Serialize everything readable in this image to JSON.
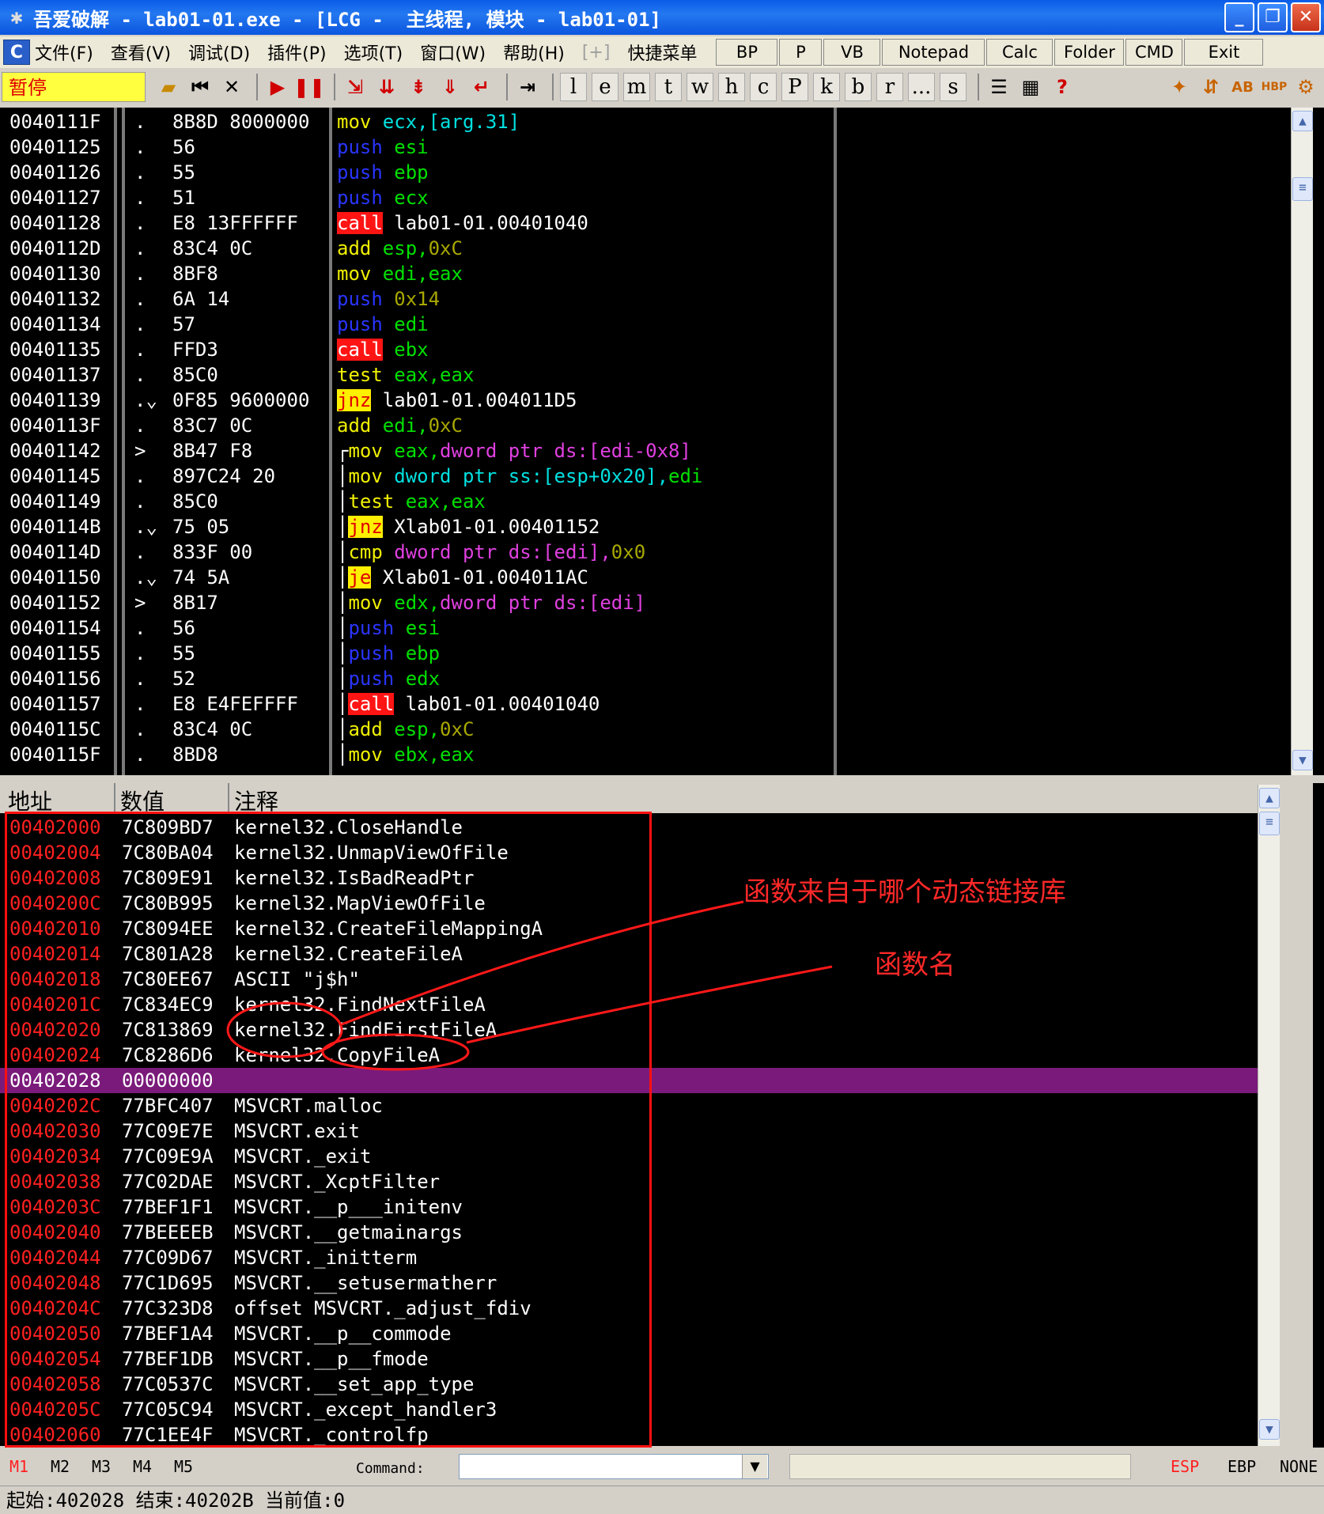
{
  "window": {
    "title": "吾爱破解 - lab01-01.exe - [LCG -  主线程, 模块 - lab01-01]"
  },
  "menu": {
    "items": [
      "文件(F)",
      "查看(V)",
      "调试(D)",
      "插件(P)",
      "选项(T)",
      "窗口(W)",
      "帮助(H)",
      "[+]",
      "快捷菜单"
    ],
    "plugin_buttons": [
      "BP",
      "P",
      "VB",
      "Notepad",
      "Calc",
      "Folder",
      "CMD",
      "Exit"
    ]
  },
  "toolbar": {
    "status": "暂停",
    "letter_buttons": [
      "l",
      "e",
      "m",
      "t",
      "w",
      "h",
      "c",
      "P",
      "k",
      "b",
      "r",
      "...",
      "s"
    ]
  },
  "disasm": {
    "rows": [
      {
        "addr": "0040111F",
        "mark": ".",
        "hex": "8B8D 8000000",
        "ins": [
          [
            "mov ",
            "c-yel"
          ],
          [
            "ecx,[arg.31]",
            "c-cyan"
          ]
        ]
      },
      {
        "addr": "00401125",
        "mark": ".",
        "hex": "56",
        "ins": [
          [
            "push ",
            "c-blue"
          ],
          [
            "esi",
            "c-green"
          ]
        ]
      },
      {
        "addr": "00401126",
        "mark": ".",
        "hex": "55",
        "ins": [
          [
            "push ",
            "c-blue"
          ],
          [
            "ebp",
            "c-green"
          ]
        ]
      },
      {
        "addr": "00401127",
        "mark": ".",
        "hex": "51",
        "ins": [
          [
            "push ",
            "c-blue"
          ],
          [
            "ecx",
            "c-green"
          ]
        ]
      },
      {
        "addr": "00401128",
        "mark": ".",
        "hex": "E8 13FFFFFF",
        "ins": [
          [
            "call",
            "c-red-bg"
          ],
          [
            " lab01-01.00401040",
            "c-white"
          ]
        ]
      },
      {
        "addr": "0040112D",
        "mark": ".",
        "hex": "83C4 0C",
        "ins": [
          [
            "add ",
            "c-yel"
          ],
          [
            "esp,",
            "c-green"
          ],
          [
            "0xC",
            "c-olive"
          ]
        ]
      },
      {
        "addr": "00401130",
        "mark": ".",
        "hex": "8BF8",
        "ins": [
          [
            "mov ",
            "c-yel"
          ],
          [
            "edi,eax",
            "c-green"
          ]
        ]
      },
      {
        "addr": "00401132",
        "mark": ".",
        "hex": "6A 14",
        "ins": [
          [
            "push ",
            "c-blue"
          ],
          [
            "0x14",
            "c-olive"
          ]
        ]
      },
      {
        "addr": "00401134",
        "mark": ".",
        "hex": "57",
        "ins": [
          [
            "push ",
            "c-blue"
          ],
          [
            "edi",
            "c-green"
          ]
        ]
      },
      {
        "addr": "00401135",
        "mark": ".",
        "hex": "FFD3",
        "ins": [
          [
            "call",
            "c-red-bg"
          ],
          [
            " ebx",
            "c-green"
          ]
        ]
      },
      {
        "addr": "00401137",
        "mark": ".",
        "hex": "85C0",
        "ins": [
          [
            "test ",
            "c-yel"
          ],
          [
            "eax,eax",
            "c-green"
          ]
        ]
      },
      {
        "addr": "00401139",
        "mark": ".⌄",
        "hex": "0F85 9600000",
        "ins": [
          [
            "jnz",
            "c-yel-bg"
          ],
          [
            " lab01-01.004011D5",
            "c-white"
          ]
        ]
      },
      {
        "addr": "0040113F",
        "mark": ".",
        "hex": "83C7 0C",
        "ins": [
          [
            "add ",
            "c-yel"
          ],
          [
            "edi,",
            "c-green"
          ],
          [
            "0xC",
            "c-olive"
          ]
        ]
      },
      {
        "addr": "00401142",
        "mark": ">",
        "hex": "8B47 F8",
        "ins": [
          [
            "┌",
            "c-white"
          ],
          [
            "mov ",
            "c-yel"
          ],
          [
            "eax,",
            "c-green"
          ],
          [
            "dword ptr ds:[edi-0x8]",
            "c-mag"
          ]
        ]
      },
      {
        "addr": "00401145",
        "mark": ".",
        "hex": "897C24 20",
        "ins": [
          [
            "│",
            "c-white"
          ],
          [
            "mov ",
            "c-yel"
          ],
          [
            "dword ptr ss:[esp+0x20],",
            "c-cyan"
          ],
          [
            "edi",
            "c-green"
          ]
        ]
      },
      {
        "addr": "00401149",
        "mark": ".",
        "hex": "85C0",
        "ins": [
          [
            "│",
            "c-white"
          ],
          [
            "test ",
            "c-yel"
          ],
          [
            "eax,eax",
            "c-green"
          ]
        ]
      },
      {
        "addr": "0040114B",
        "mark": ".⌄",
        "hex": "75 05",
        "ins": [
          [
            "│",
            "c-white"
          ],
          [
            "jnz",
            "c-yel-bg"
          ],
          [
            " Xlab01-01.00401152",
            "c-white"
          ]
        ]
      },
      {
        "addr": "0040114D",
        "mark": ".",
        "hex": "833F 00",
        "ins": [
          [
            "│",
            "c-white"
          ],
          [
            "cmp ",
            "c-yel"
          ],
          [
            "dword ptr ds:[edi],",
            "c-mag"
          ],
          [
            "0x0",
            "c-olive"
          ]
        ]
      },
      {
        "addr": "00401150",
        "mark": ".⌄",
        "hex": "74 5A",
        "ins": [
          [
            "│",
            "c-white"
          ],
          [
            "je",
            "c-yel-bg"
          ],
          [
            " Xlab01-01.004011AC",
            "c-white"
          ]
        ]
      },
      {
        "addr": "00401152",
        "mark": ">",
        "hex": "8B17",
        "ins": [
          [
            "│",
            "c-white"
          ],
          [
            "mov ",
            "c-yel"
          ],
          [
            "edx,",
            "c-green"
          ],
          [
            "dword ptr ds:[edi]",
            "c-mag"
          ]
        ]
      },
      {
        "addr": "00401154",
        "mark": ".",
        "hex": "56",
        "ins": [
          [
            "│",
            "c-white"
          ],
          [
            "push ",
            "c-blue"
          ],
          [
            "esi",
            "c-green"
          ]
        ]
      },
      {
        "addr": "00401155",
        "mark": ".",
        "hex": "55",
        "ins": [
          [
            "│",
            "c-white"
          ],
          [
            "push ",
            "c-blue"
          ],
          [
            "ebp",
            "c-green"
          ]
        ]
      },
      {
        "addr": "00401156",
        "mark": ".",
        "hex": "52",
        "ins": [
          [
            "│",
            "c-white"
          ],
          [
            "push ",
            "c-blue"
          ],
          [
            "edx",
            "c-green"
          ]
        ]
      },
      {
        "addr": "00401157",
        "mark": ".",
        "hex": "E8 E4FEFFFF",
        "ins": [
          [
            "│",
            "c-white"
          ],
          [
            "call",
            "c-red-bg"
          ],
          [
            " lab01-01.00401040",
            "c-white"
          ]
        ]
      },
      {
        "addr": "0040115C",
        "mark": ".",
        "hex": "83C4 0C",
        "ins": [
          [
            "│",
            "c-white"
          ],
          [
            "add ",
            "c-yel"
          ],
          [
            "esp,",
            "c-green"
          ],
          [
            "0xC",
            "c-olive"
          ]
        ]
      },
      {
        "addr": "0040115F",
        "mark": ".",
        "hex": "8BD8",
        "ins": [
          [
            "│",
            "c-white"
          ],
          [
            "mov ",
            "c-yel"
          ],
          [
            "ebx,eax",
            "c-green"
          ]
        ]
      }
    ]
  },
  "dump": {
    "headers": {
      "addr": "地址",
      "value": "数值",
      "comment": "注释"
    },
    "rows": [
      {
        "addr": "00402000",
        "value": "7C809BD7",
        "comment": "kernel32.CloseHandle"
      },
      {
        "addr": "00402004",
        "value": "7C80BA04",
        "comment": "kernel32.UnmapViewOfFile"
      },
      {
        "addr": "00402008",
        "value": "7C809E91",
        "comment": "kernel32.IsBadReadPtr"
      },
      {
        "addr": "0040200C",
        "value": "7C80B995",
        "comment": "kernel32.MapViewOfFile"
      },
      {
        "addr": "00402010",
        "value": "7C8094EE",
        "comment": "kernel32.CreateFileMappingA"
      },
      {
        "addr": "00402014",
        "value": "7C801A28",
        "comment": "kernel32.CreateFileA"
      },
      {
        "addr": "00402018",
        "value": "7C80EE67",
        "comment": "ASCII \"j$h\""
      },
      {
        "addr": "0040201C",
        "value": "7C834EC9",
        "comment": "kernel32.FindNextFileA"
      },
      {
        "addr": "00402020",
        "value": "7C813869",
        "comment": "kernel32.FindFirstFileA"
      },
      {
        "addr": "00402024",
        "value": "7C8286D6",
        "comment": "kernel32.CopyFileA"
      },
      {
        "addr": "00402028",
        "value": "00000000",
        "comment": "",
        "highlight": true
      },
      {
        "addr": "0040202C",
        "value": "77BFC407",
        "comment": "MSVCRT.malloc"
      },
      {
        "addr": "00402030",
        "value": "77C09E7E",
        "comment": "MSVCRT.exit"
      },
      {
        "addr": "00402034",
        "value": "77C09E9A",
        "comment": "MSVCRT._exit"
      },
      {
        "addr": "00402038",
        "value": "77C02DAE",
        "comment": "MSVCRT._XcptFilter"
      },
      {
        "addr": "0040203C",
        "value": "77BEF1F1",
        "comment": "MSVCRT.__p___initenv"
      },
      {
        "addr": "00402040",
        "value": "77BEEEEB",
        "comment": "MSVCRT.__getmainargs"
      },
      {
        "addr": "00402044",
        "value": "77C09D67",
        "comment": "MSVCRT._initterm"
      },
      {
        "addr": "00402048",
        "value": "77C1D695",
        "comment": "MSVCRT.__setusermatherr"
      },
      {
        "addr": "0040204C",
        "value": "77C323D8",
        "comment": "offset MSVCRT._adjust_fdiv"
      },
      {
        "addr": "00402050",
        "value": "77BEF1A4",
        "comment": "MSVCRT.__p__commode"
      },
      {
        "addr": "00402054",
        "value": "77BEF1DB",
        "comment": "MSVCRT.__p__fmode"
      },
      {
        "addr": "00402058",
        "value": "77C0537C",
        "comment": "MSVCRT.__set_app_type"
      },
      {
        "addr": "0040205C",
        "value": "77C05C94",
        "comment": "MSVCRT._except_handler3"
      },
      {
        "addr": "00402060",
        "value": "77C1EE4F",
        "comment": "MSVCRT._controlfp"
      }
    ]
  },
  "annotations": {
    "dll_label": "函数来自于哪个动态链接库",
    "func_label": "函数名"
  },
  "bottom": {
    "markers": [
      "M1",
      "M2",
      "M3",
      "M4",
      "M5"
    ],
    "command_label": "Command:",
    "command_value": "",
    "registers": [
      "ESP",
      "EBP",
      "NONE"
    ]
  },
  "status": {
    "text": "起始:402028 结束:40202B 当前值:0"
  }
}
